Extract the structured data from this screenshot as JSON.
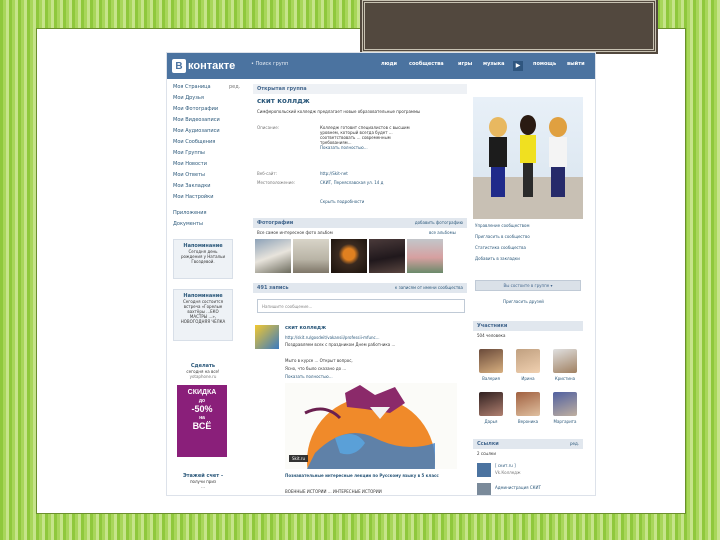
{
  "header": {
    "logo_letter": "B",
    "logo_text": "контакте",
    "search": "• Поиск групп",
    "nav": [
      "люди",
      "сообщества",
      "игры",
      "музыка",
      "помощь",
      "выйти"
    ]
  },
  "left_menu": [
    "Моя Страница",
    "Мои Друзья",
    "Мои Фотографии",
    "Мои Видеозаписи",
    "Мои Аудиозаписи",
    "Мои Сообщения",
    "Мои Группы",
    "Мои Новости",
    "Мои Ответы",
    "Мои Закладки",
    "Мои Настройки",
    "Приложения",
    "Документы"
  ],
  "left_menu_edit": "ред.",
  "reminder": {
    "title": "Напоминание",
    "lines": [
      "Сегодня день",
      "рождения у Натальи",
      "Гвоздевой."
    ]
  },
  "reminder2": {
    "title": "Напоминание",
    "lines": [
      "Сегодня состоится",
      "встреча «Горелые",
      "вахтёры ...ЕКО",
      "МАСТРЫ ...»,",
      "НОВОГОДНЯЯ ЧЕЛКА",
      "и"
    ]
  },
  "ad1": {
    "title": "Сделать",
    "text": "сегодня на все!",
    "sub": "yotaphone.ru"
  },
  "ad_banner": {
    "line1": "СКИДКА",
    "line2": "до",
    "line3": "-50%",
    "line4": "на",
    "line5": "ВСЁ"
  },
  "ad2": {
    "title": "Этажей счет -",
    "text": "получи приз",
    "sub": "..."
  },
  "group": {
    "type": "Открытая группа",
    "name": "скит коллдж",
    "status": "Симферопольский колледж предлагает новые образовательные программы",
    "info_label": "Описание:",
    "info": [
      "Колледж готовит специалистов с высшим",
      "уровнем, который всегда будет ...",
      "соответствовать ... современным",
      "требованиям..."
    ],
    "more": "Показать полностью...",
    "site_label": "Веб-сайт:",
    "site": "http://Skit-net",
    "addr_label": "Местоположение:",
    "addr": "СКИТ, Переяславская ул. 14 д",
    "hide": "Скрыть подробности"
  },
  "photos": {
    "title": "Фотографии",
    "add": "добавить фотографию",
    "album": "Все самое интересное фото альбом",
    "all": "все альбомы"
  },
  "wall": {
    "count": "491 запись",
    "filter": "к записям от имени сообщества",
    "placeholder": "Напишите сообщение...",
    "author": "скит колледж",
    "link": "http://skit.ru/gosdeit/vakansii/professii-mfunc...",
    "link2": "Поздравляем всех с праздником Днем работника ...",
    "t1": "Мыто в курсе ... Открыт вопрос,",
    "t2": "Ясно, что было сказано до ...",
    "more": "Показать полностью...",
    "video": "Skit.ru",
    "caption": "Познавательные интересные лекции по Русскому языку в 5 класс",
    "sub": "ВОЕННЫЕ ИСТОРИИ ... ИНТЕРЕСНЫЕ ИСТОРИИ"
  },
  "right": {
    "actions": [
      "Управление сообществом",
      "Пригласить в сообщество",
      "Статистика сообщества",
      "Добавить в закладки"
    ],
    "subscribe": "Вы состоите в группе ▾",
    "invite": "Пригласить друзей",
    "members_title": "Участники",
    "members_count": "504 человека",
    "members": [
      "Валерия",
      "Ирина",
      "Кристина",
      "Дарья",
      "Вероника",
      "Маргарита"
    ],
    "links_title": "Ссылки",
    "links_count": "2 ссылки",
    "links_all": "ред.",
    "link1": "[ скит.ru ]",
    "link1_sub": "Vk.Колледж",
    "link2": "Администрация СКИТ"
  },
  "colors": {
    "header": "#4b73a0",
    "link": "#2b587a",
    "slide_green": "#8fc83c",
    "deco": "#52483e",
    "ad_purple": "#8a1f7a"
  }
}
